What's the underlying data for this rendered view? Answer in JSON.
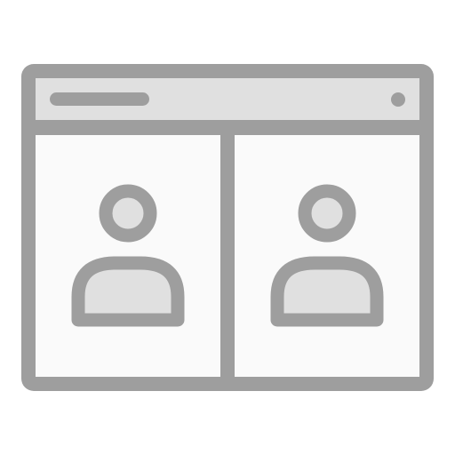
{
  "icon": {
    "name": "browser-window-two-users-icon",
    "colors": {
      "stroke": "#9e9e9e",
      "titlebar_fill": "#e0e0e0",
      "pane_fill": "#fafafa",
      "avatar_fill": "#e0e0e0",
      "background": "#ffffff"
    },
    "parts": {
      "titlebar": {
        "url_bar_icon": "address-bar-placeholder",
        "status_dot_icon": "dot"
      },
      "panes": [
        {
          "avatar_icon": "user-avatar-icon"
        },
        {
          "avatar_icon": "user-avatar-icon"
        }
      ]
    }
  }
}
